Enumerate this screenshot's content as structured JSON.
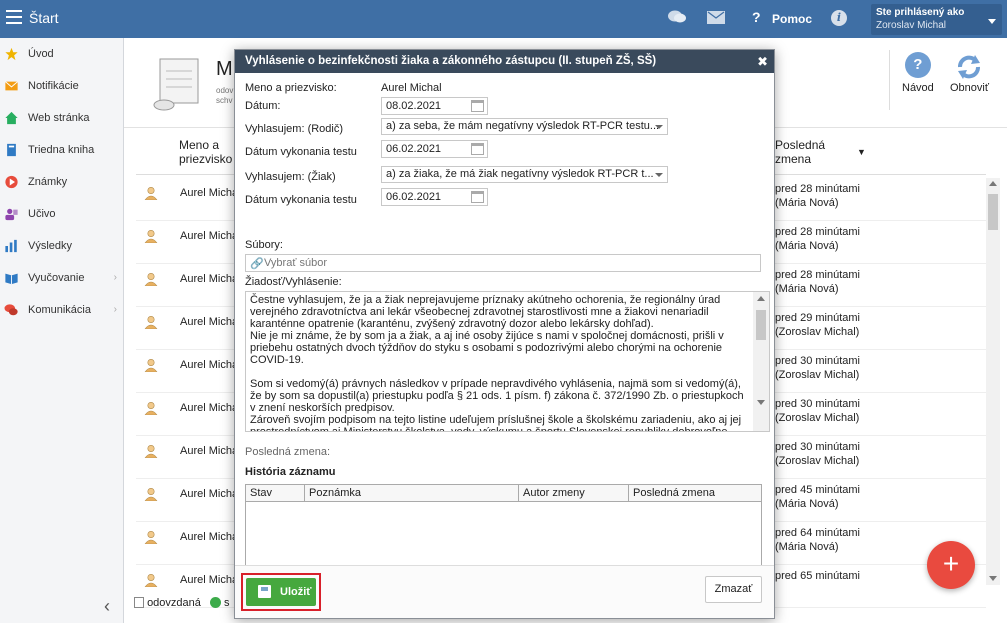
{
  "topbar": {
    "title": "Štart",
    "help_label": "Pomoc",
    "user_line1": "Ste prihlásený ako",
    "user_line2": "Zoroslav Michal",
    "accent": "#3f6fa5"
  },
  "sidebar": {
    "items": [
      {
        "label": "Úvod",
        "icon": "star-icon",
        "color": "#f0b400"
      },
      {
        "label": "Notifikácie",
        "icon": "envelope-icon",
        "color": "#f39c12"
      },
      {
        "label": "Web stránka",
        "icon": "home-icon",
        "color": "#27ae60"
      },
      {
        "label": "Triedna kniha",
        "icon": "book-icon",
        "color": "#2f7ac4"
      },
      {
        "label": "Známky",
        "icon": "grade-icon",
        "color": "#e74c3c"
      },
      {
        "label": "Učivo",
        "icon": "learning-icon",
        "color": "#8e44ad"
      },
      {
        "label": "Výsledky",
        "icon": "bar-chart-icon",
        "color": "#2f7ac4"
      },
      {
        "label": "Vyučovanie",
        "icon": "open-book-icon",
        "color": "#2f7ac4"
      },
      {
        "label": "Komunikácia",
        "icon": "chat-bubbles-icon",
        "color": "#e74c3c"
      }
    ]
  },
  "page": {
    "title_stub": "M",
    "sub_l1": "odov",
    "sub_l2": "schv",
    "toolbar": {
      "guide": "Návod",
      "refresh": "Obnoviť"
    },
    "columns": {
      "name_l1": "Meno a",
      "name_l2": "priezvisko",
      "last_l1": "Posledná",
      "last_l2": "zmena"
    },
    "rows": [
      {
        "name": "Aurel Micha",
        "time": "pred 28 minútami",
        "who": "(Mária Nová)"
      },
      {
        "name": "Aurel Micha",
        "time": "pred 28 minútami",
        "who": "(Mária Nová)"
      },
      {
        "name": "Aurel Micha",
        "time": "pred 28 minútami",
        "who": "(Mária Nová)"
      },
      {
        "name": "Aurel Micha",
        "time": "pred 29 minútami",
        "who": "(Zoroslav Michal)"
      },
      {
        "name": "Aurel Micha",
        "time": "pred 30 minútami",
        "who": "(Zoroslav Michal)"
      },
      {
        "name": "Aurel Micha",
        "time": "pred 30 minútami",
        "who": "(Zoroslav Michal)"
      },
      {
        "name": "Aurel Micha",
        "time": "pred 30 minútami",
        "who": "(Zoroslav Michal)"
      },
      {
        "name": "Aurel Micha",
        "time": "pred 45 minútami",
        "who": "(Mária Nová)"
      },
      {
        "name": "Aurel Micha",
        "time": "pred 64 minútami",
        "who": "(Mária Nová)"
      },
      {
        "name": "Aurel Micha",
        "time": "pred 65 minútami",
        "who": ""
      }
    ],
    "legend": {
      "handed": "odovzdaná",
      "approved_stub": "s"
    }
  },
  "modal": {
    "title": "Vyhlásenie o bezinfekčnosti žiaka a zákonného zástupcu (II. stupeň ZŠ, SŠ)",
    "name_label": "Meno a priezvisko:",
    "name_value": "Aurel Michal",
    "date_label": "Dátum:",
    "date_value": "08.02.2021",
    "parent_label": "Vyhlasujem: (Rodič)",
    "parent_value": "a) za seba, že mám negatívny výsledok RT-PCR testu...",
    "parent_test_label": "Dátum vykonania testu",
    "parent_test_value": "06.02.2021",
    "pupil_label": "Vyhlasujem: (Žiak)",
    "pupil_value": "a) za žiaka, že má žiak negatívny výsledok RT-PCR t...",
    "pupil_test_label": "Dátum vykonania testu",
    "pupil_test_value": "06.02.2021",
    "files_label": "Súbory:",
    "files_placeholder": "Vybrať súbor",
    "request_label": "Žiadosť/Vyhlásenie:",
    "text_p1": "Čestne vyhlasujem, že ja a žiak neprejavujeme príznaky akútneho ochorenia, že regionálny úrad verejného zdravotníctva ani lekár všeobecnej zdravotnej starostlivosti mne a žiakovi nenariadil karanténne opatrenie (karanténu, zvýšený zdravotný dozor alebo lekársky dohľad).",
    "text_p2": "Nie je mi známe, že by som ja a žiak, a aj iné osoby žijúce s nami v spoločnej domácnosti, prišli v priebehu ostatných dvoch týždňov do styku s osobami s podozrivými alebo chorými na ochorenie COVID-19.",
    "text_p3": "Som si vedomý(á) právnych následkov v prípade nepravdivého vyhlásenia, najmä som si vedomý(á), že by som sa dopustil(a) priestupku podľa § 21 ods. 1 písm. f) zákona č. 372/1990 Zb. o priestupkoch v znení neskorších predpisov.",
    "text_p4": "Zároveň svojím podpisom na tejto listine udeľujem príslušnej škole a školskému zariadeniu, ako aj jej prostredníctvom aj Ministerstvu školstva, vedy, výskumu a športu Slovenskej republiky dobrovoľne súhlas",
    "last_change_label": "Posledná zmena:",
    "history_title": "História záznamu",
    "history_columns": [
      "Stav",
      "Poznámka",
      "Autor zmeny",
      "Posledná zmena"
    ],
    "save_label": "Uložiť",
    "clear_label": "Zmazať"
  }
}
